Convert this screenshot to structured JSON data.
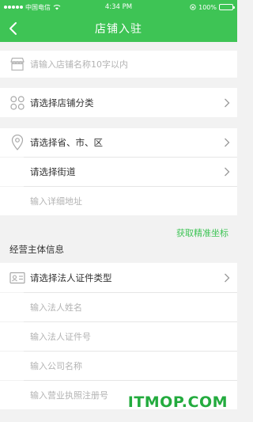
{
  "status_bar": {
    "carrier": "中国电信",
    "time": "4:34 PM",
    "battery": "100%"
  },
  "nav": {
    "title": "店铺入驻"
  },
  "form": {
    "shop_name_placeholder": "请输入店铺名称10字以内",
    "category_label": "请选择店铺分类",
    "region_label": "请选择省、市、区",
    "street_label": "请选择街道",
    "address_placeholder": "输入详细地址",
    "get_coords_link": "获取精准坐标",
    "section_title": "经营主体信息",
    "id_type_label": "请选择法人证件类型",
    "legal_name_placeholder": "输入法人姓名",
    "legal_id_placeholder": "输入法人证件号",
    "company_name_placeholder": "输入公司名称",
    "license_no_placeholder": "输入营业执照注册号"
  },
  "watermark": "ITMOP.COM",
  "colors": {
    "brand": "#3ec455",
    "link": "#3ec455",
    "watermark": "#23ab3e"
  }
}
